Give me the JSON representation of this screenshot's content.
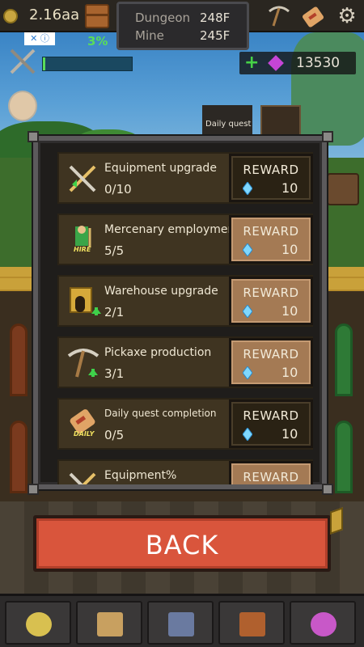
{
  "hud": {
    "gold_amount": "2.16aa",
    "dungeon_label": "Dungeon",
    "dungeon_floor": "248F",
    "mine_label": "Mine",
    "mine_floor": "245F",
    "xp_percent": "3%",
    "xp_fraction": 0.03,
    "gem_count": "13530",
    "daily_quest_label": "Daily quest"
  },
  "quests": [
    {
      "title": "Equipment upgrade",
      "progress": "0/10",
      "reward_label": "REWARD",
      "reward_amount": "10",
      "state": "locked",
      "icon": "crossed-swords-icon"
    },
    {
      "title": "Mercenary employment",
      "progress": "5/5",
      "reward_label": "REWARD",
      "reward_amount": "10",
      "state": "claimable",
      "icon": "hire-mercenary-icon",
      "icon_badge": "HIRE"
    },
    {
      "title": "Warehouse upgrade",
      "progress": "2/1",
      "reward_label": "REWARD",
      "reward_amount": "10",
      "state": "claimable",
      "icon": "warehouse-icon"
    },
    {
      "title": "Pickaxe production",
      "progress": "3/1",
      "reward_label": "REWARD",
      "reward_amount": "10",
      "state": "claimable",
      "icon": "pickaxe-icon"
    },
    {
      "title": "Daily quest completion",
      "progress": "0/5",
      "reward_label": "REWARD",
      "reward_amount": "10",
      "state": "locked",
      "icon": "daily-scroll-icon",
      "icon_badge": "DAILY"
    },
    {
      "title": "Equipment%",
      "progress": "",
      "reward_label": "REWARD",
      "reward_amount": "",
      "state": "claimable",
      "icon": "crossed-swords-icon"
    }
  ],
  "back_button": {
    "label": "BACK"
  },
  "nav": {
    "items": [
      "hero-nav-icon",
      "weapons-nav-icon",
      "mercenary-nav-icon",
      "chest-nav-icon",
      "shop-nav-icon"
    ]
  },
  "colors": {
    "reward_claimable": "#a47a54",
    "reward_locked": "#2a2214",
    "back_button": "#d9553c",
    "xp_green": "#5adc5a",
    "gem_purple": "#c545d6"
  }
}
